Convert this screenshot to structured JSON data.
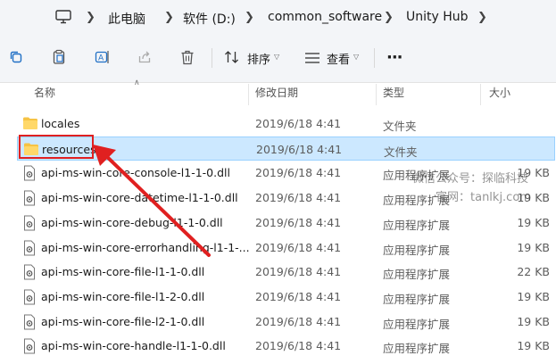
{
  "breadcrumb": {
    "items": [
      "此电脑",
      "软件 (D:)",
      "common_software",
      "Unity Hub"
    ]
  },
  "toolbar": {
    "sort_label": "排序",
    "view_label": "查看",
    "more_label": "···"
  },
  "columns": {
    "name": "名称",
    "modified": "修改日期",
    "type": "类型",
    "size": "大小"
  },
  "rows": [
    {
      "name": "locales",
      "modified": "2019/6/18 4:41",
      "type": "文件夹",
      "size": "",
      "kind": "folder"
    },
    {
      "name": "resources",
      "modified": "2019/6/18 4:41",
      "type": "文件夹",
      "size": "",
      "kind": "folder",
      "selected": true
    },
    {
      "name": "api-ms-win-core-console-l1-1-0.dll",
      "modified": "2019/6/18 4:41",
      "type": "应用程序扩展",
      "size": "19 KB",
      "kind": "dll"
    },
    {
      "name": "api-ms-win-core-datetime-l1-1-0.dll",
      "modified": "2019/6/18 4:41",
      "type": "应用程序扩展",
      "size": "19 KB",
      "kind": "dll"
    },
    {
      "name": "api-ms-win-core-debug-l1-1-0.dll",
      "modified": "2019/6/18 4:41",
      "type": "应用程序扩展",
      "size": "19 KB",
      "kind": "dll"
    },
    {
      "name": "api-ms-win-core-errorhandling-l1-1-...",
      "modified": "2019/6/18 4:41",
      "type": "应用程序扩展",
      "size": "19 KB",
      "kind": "dll"
    },
    {
      "name": "api-ms-win-core-file-l1-1-0.dll",
      "modified": "2019/6/18 4:41",
      "type": "应用程序扩展",
      "size": "22 KB",
      "kind": "dll"
    },
    {
      "name": "api-ms-win-core-file-l1-2-0.dll",
      "modified": "2019/6/18 4:41",
      "type": "应用程序扩展",
      "size": "19 KB",
      "kind": "dll"
    },
    {
      "name": "api-ms-win-core-file-l2-1-0.dll",
      "modified": "2019/6/18 4:41",
      "type": "应用程序扩展",
      "size": "19 KB",
      "kind": "dll"
    },
    {
      "name": "api-ms-win-core-handle-l1-1-0.dll",
      "modified": "2019/6/18 4:41",
      "type": "应用程序扩展",
      "size": "19 KB",
      "kind": "dll"
    }
  ],
  "watermark": {
    "line1": "微信公众号：探临科技",
    "line2": "官网：tanlkj.com"
  },
  "colors": {
    "selection_bg": "#cce8ff",
    "selection_border": "#99d1ff",
    "annotation": "#e02020",
    "folder": "#f6c344"
  }
}
